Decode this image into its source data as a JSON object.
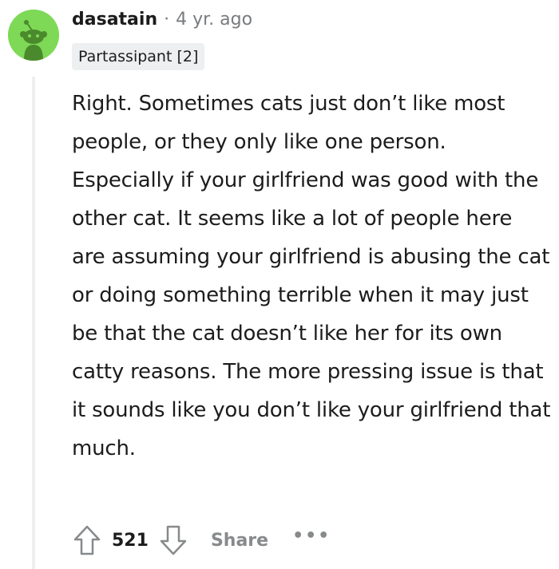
{
  "comment": {
    "author": "dasatain",
    "separator": "·",
    "timestamp": "4 yr. ago",
    "flair": "Partassipant [2]",
    "body": "Right. Sometimes cats just don’t like most people, or they only like one person. Especially if your girlfriend was good with the other cat. It seems like a lot of people here are assuming your girlfriend is abusing the cat or doing something terrible when it may just be that the cat doesn’t like her for its own catty reasons. The more pressing issue is that it sounds like you don’t like your girlfriend that much.",
    "avatar_color": "#7ed957",
    "thread_line_color": "#edeff1"
  },
  "actions": {
    "upvote_icon": "arrow-up-outline",
    "score": "521",
    "downvote_icon": "arrow-down-outline",
    "share_label": "Share",
    "more_label": "•••"
  }
}
